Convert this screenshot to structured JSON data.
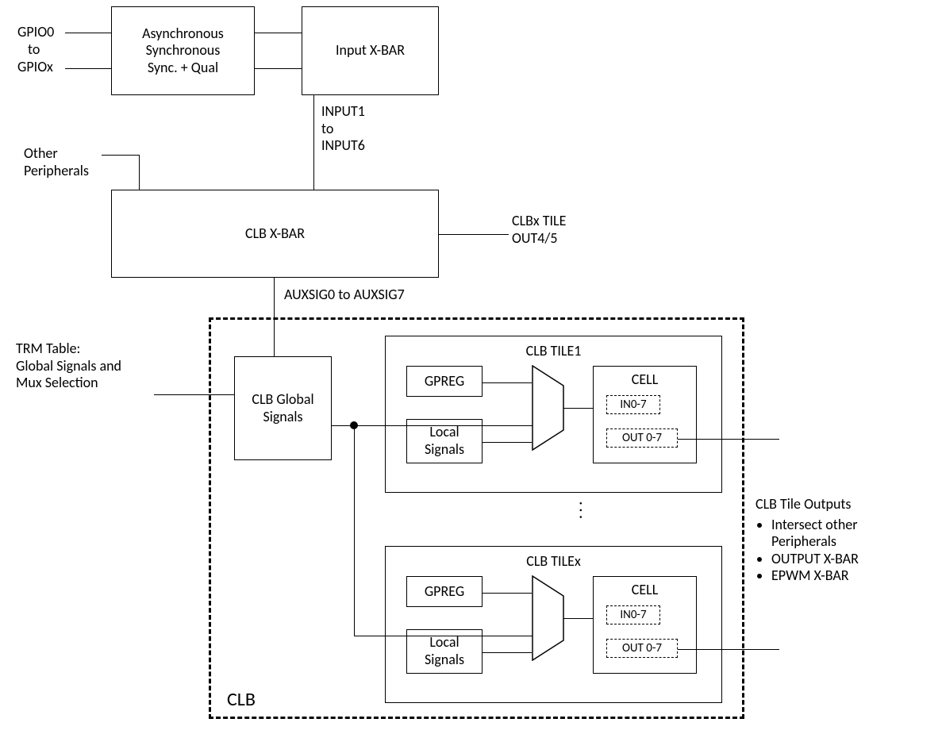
{
  "gpio": {
    "top": "GPIO0",
    "mid": "to",
    "bot": "GPIOx"
  },
  "async_box": "Asynchronous\nSynchronous\nSync. + Qual",
  "input_xbar": "Input X-BAR",
  "inputs_label": "INPUT1\nto\nINPUT6",
  "other_periph": "Other\nPeripherals",
  "clb_xbar": "CLB X-BAR",
  "clbx_tile_out": "CLBx TILE\nOUT4/5",
  "auxsig": "AUXSIG0 to AUXSIG7",
  "trm": "TRM Table:\nGlobal Signals and\nMux Selection",
  "clb_global": "CLB Global\nSignals",
  "clb_title": "CLB",
  "tiles": [
    {
      "title": "CLB TILE1",
      "gpreg": "GPREG",
      "local": "Local\nSignals",
      "cell": "CELL",
      "in": "IN0-7",
      "out": "OUT 0-7"
    },
    {
      "title": "CLB TILEx",
      "gpreg": "GPREG",
      "local": "Local\nSignals",
      "cell": "CELL",
      "in": "IN0-7",
      "out": "OUT 0-7"
    }
  ],
  "outputs": {
    "heading": "CLB Tile Outputs",
    "items": [
      "Intersect other\nPeripherals",
      "OUTPUT X-BAR",
      "EPWM X-BAR"
    ]
  },
  "ellipsis": "· · ·"
}
